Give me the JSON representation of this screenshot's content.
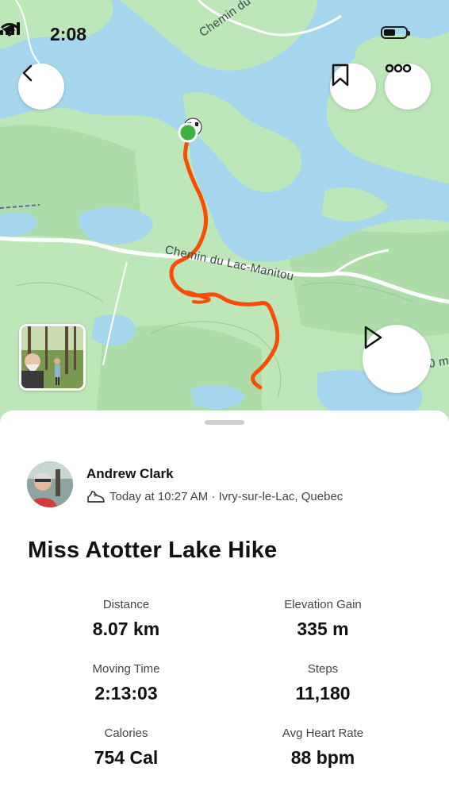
{
  "status_bar": {
    "time": "2:08"
  },
  "map": {
    "labels": {
      "road_1": "Chemin du Colibri",
      "road_2": "Chemin du Lac-Manitou",
      "edge_label": "0 m"
    }
  },
  "activity": {
    "athlete_name": "Andrew Clark",
    "meta": "Today at 10:27 AM · Ivry-sur-le-Lac, Quebec",
    "title": "Miss Atotter Lake Hike"
  },
  "stats": [
    {
      "label": "Distance",
      "value": "8.07 km"
    },
    {
      "label": "Elevation Gain",
      "value": "335 m"
    },
    {
      "label": "Moving Time",
      "value": "2:13:03"
    },
    {
      "label": "Steps",
      "value": "11,180"
    },
    {
      "label": "Calories",
      "value": "754 Cal"
    },
    {
      "label": "Avg Heart Rate",
      "value": "88 bpm"
    }
  ],
  "icons": {
    "back": "chevron-left-icon",
    "bookmark": "bookmark-icon",
    "more": "more-dots-icon",
    "play": "play-icon",
    "shoe": "shoe-icon",
    "location": "location-arrow-icon"
  },
  "colors": {
    "route": "#fc4c02",
    "start_marker": "#3db33d",
    "water": "#a6d6ee",
    "land": "#bde7b8"
  }
}
